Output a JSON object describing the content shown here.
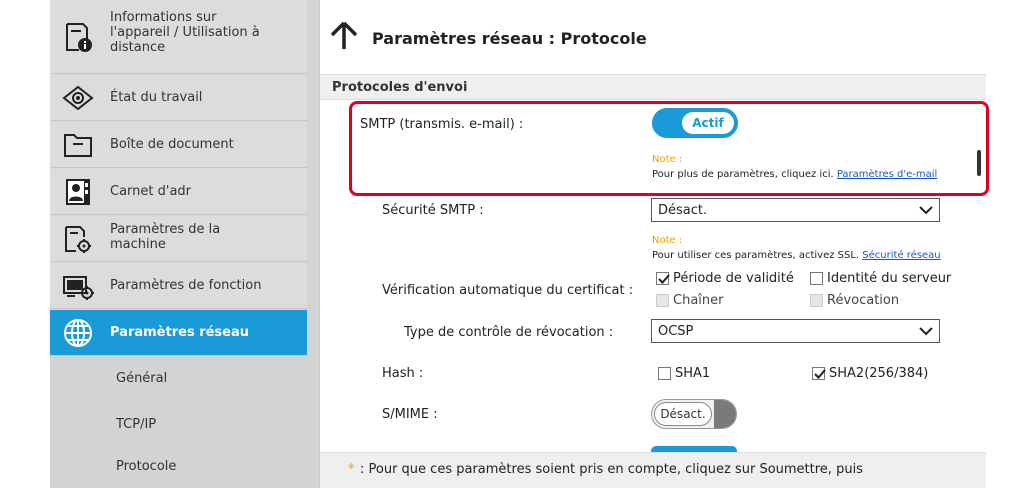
{
  "sidebar": {
    "items": [
      {
        "label_lines": [
          "Informations sur",
          "l'appareil / Utilisation à",
          "distance"
        ],
        "icon": "device-info-icon"
      },
      {
        "label": "État du travail",
        "icon": "eye-icon"
      },
      {
        "label": "Boîte de document",
        "icon": "folder-icon"
      },
      {
        "label": "Carnet d'adr",
        "icon": "address-book-icon"
      },
      {
        "label_lines": [
          "Paramètres de la",
          "machine"
        ],
        "icon": "machine-settings-icon"
      },
      {
        "label": "Paramètres de fonction",
        "icon": "function-settings-icon"
      },
      {
        "label": "Paramètres réseau",
        "icon": "globe-icon"
      }
    ],
    "subitems": [
      "Général",
      "TCP/IP",
      "Protocole"
    ]
  },
  "main": {
    "title": "Paramètres réseau : Protocole",
    "section": "Protocoles d'envoi",
    "smtp": {
      "label": "SMTP (transmis. e-mail) :",
      "toggle": "Actif",
      "note_title": "Note :",
      "note_text": "Pour plus de paramètres, cliquez ici. ",
      "note_link": "Paramètres d'e-mail"
    },
    "smtp_security": {
      "label": "Sécurité SMTP :",
      "value": "Désact.",
      "note_title": "Note :",
      "note_text": "Pour utiliser ces paramètres, activez SSL. ",
      "note_link": "Sécurité réseau"
    },
    "cert_check": {
      "label": "Vérification automatique du certificat :",
      "options": [
        {
          "label": "Période de validité",
          "checked": true,
          "disabled": false
        },
        {
          "label": "Identité du serveur",
          "checked": false,
          "disabled": false
        },
        {
          "label": "Chaîner",
          "checked": false,
          "disabled": true
        },
        {
          "label": "Révocation",
          "checked": false,
          "disabled": true
        }
      ]
    },
    "revocation_type": {
      "label": "Type de contrôle de révocation :",
      "value": "OCSP"
    },
    "hash": {
      "label": "Hash :",
      "options": [
        {
          "label": "SHA1",
          "checked": false
        },
        {
          "label": "SHA2(256/384)",
          "checked": true
        }
      ]
    },
    "smime": {
      "label": "S/MIME :",
      "toggle": "Désact."
    },
    "footer": {
      "star": "*",
      "text": ": Pour que ces paramètres soient pris en compte, cliquez sur Soumettre, puis"
    }
  },
  "colors": {
    "accent": "#1a9ad6",
    "highlight": "#e0001b",
    "note": "#f0a000",
    "link": "#1556c6"
  }
}
